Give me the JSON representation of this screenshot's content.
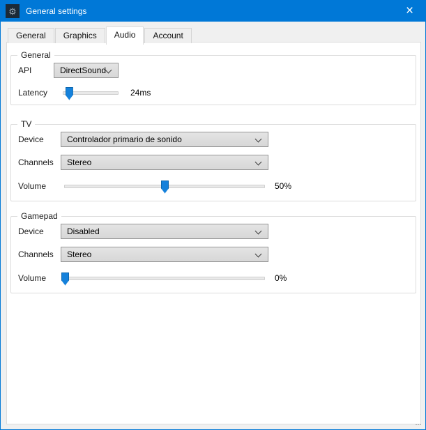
{
  "window": {
    "title": "General settings",
    "close_glyph": "×"
  },
  "icons": {
    "app_icon": "gear-icon",
    "app_icon_glyph": "⚙"
  },
  "colors": {
    "titlebar": "#0078d7",
    "accent_thumb": "#1581db",
    "client_bg": "#f0f0f0",
    "page_bg": "#ffffff"
  },
  "tabs": [
    {
      "label": "General",
      "selected": false
    },
    {
      "label": "Graphics",
      "selected": false
    },
    {
      "label": "Audio",
      "selected": true
    },
    {
      "label": "Account",
      "selected": false
    }
  ],
  "groups": {
    "general": {
      "title": "General",
      "api": {
        "label": "API",
        "value": "DirectSound"
      },
      "latency": {
        "label": "Latency",
        "value": "24ms",
        "percent": 10
      }
    },
    "tv": {
      "title": "TV",
      "device": {
        "label": "Device",
        "value": "Controlador primario de sonido"
      },
      "channels": {
        "label": "Channels",
        "value": "Stereo"
      },
      "volume": {
        "label": "Volume",
        "value": "50%",
        "percent": 50
      }
    },
    "gamepad": {
      "title": "Gamepad",
      "device": {
        "label": "Device",
        "value": "Disabled"
      },
      "channels": {
        "label": "Channels",
        "value": "Stereo"
      },
      "volume": {
        "label": "Volume",
        "value": "0%",
        "percent": 0
      }
    }
  }
}
